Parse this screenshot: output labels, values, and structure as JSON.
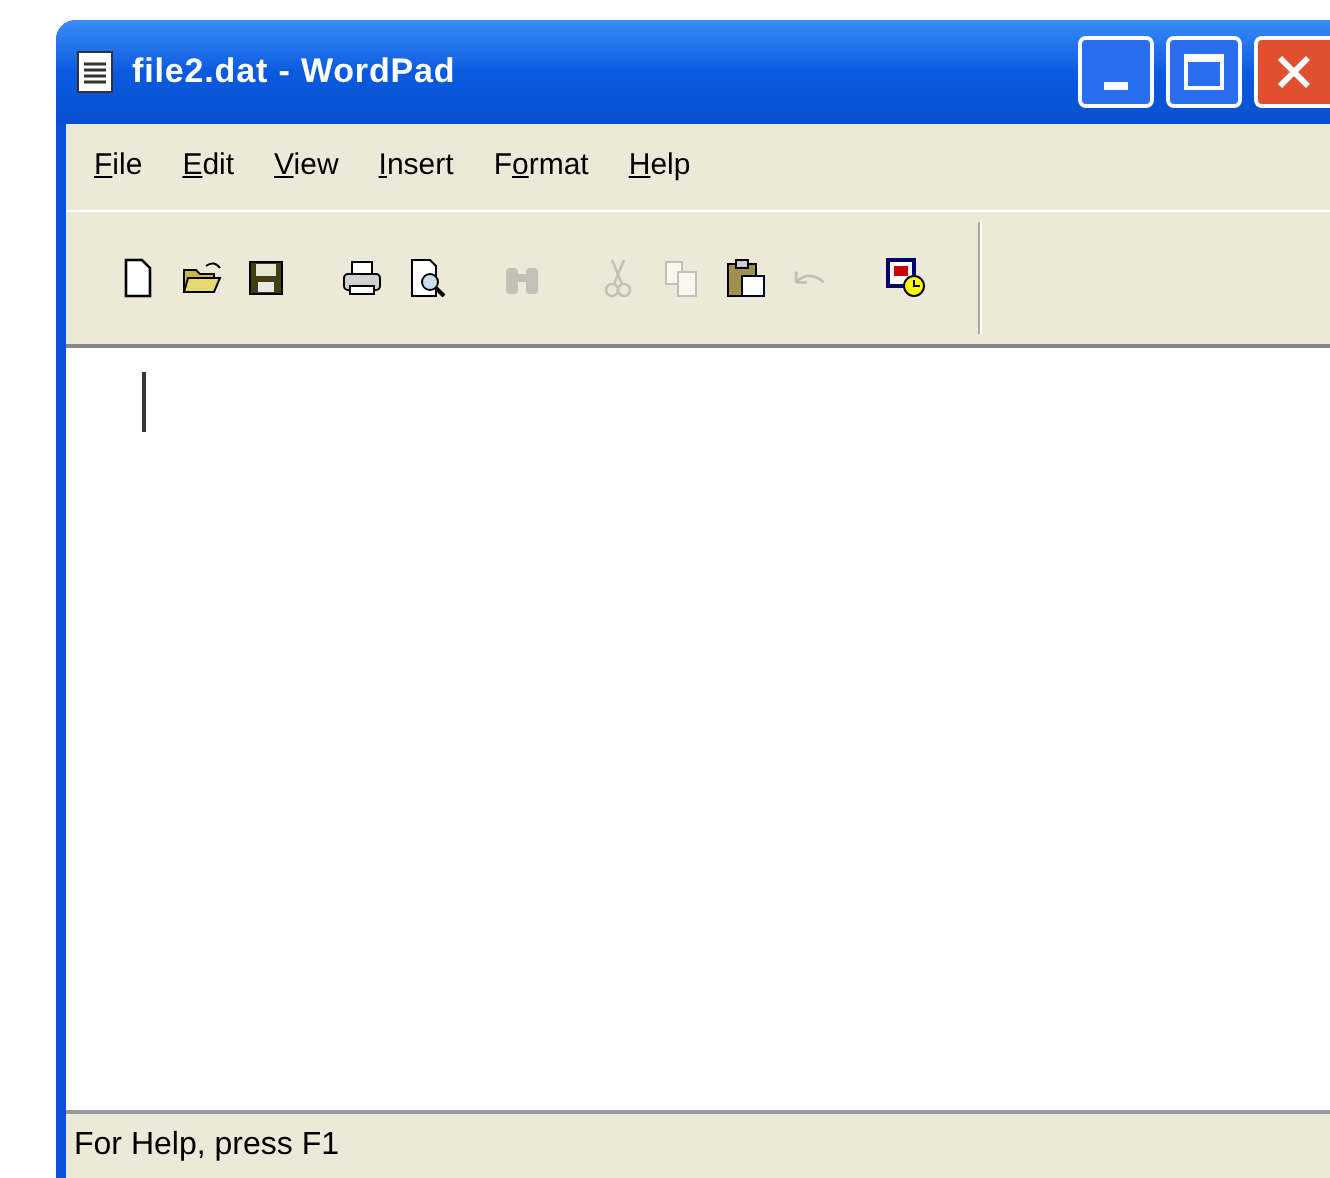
{
  "window": {
    "title": "file2.dat - WordPad"
  },
  "menu": [
    {
      "key": "F",
      "after": "ile"
    },
    {
      "key": "E",
      "after": "dit"
    },
    {
      "key": "V",
      "after": "iew"
    },
    {
      "key": "I",
      "after": "nsert"
    },
    {
      "before": "F",
      "key": "o",
      "after": "rmat"
    },
    {
      "key": "H",
      "after": "elp"
    }
  ],
  "toolbar": [
    {
      "kind": "new",
      "disabled": false
    },
    {
      "kind": "open",
      "disabled": false
    },
    {
      "kind": "save",
      "disabled": false
    },
    {
      "kind": "separator"
    },
    {
      "kind": "print",
      "disabled": false
    },
    {
      "kind": "preview",
      "disabled": false
    },
    {
      "kind": "separator"
    },
    {
      "kind": "find",
      "disabled": true
    },
    {
      "kind": "separator"
    },
    {
      "kind": "cut",
      "disabled": true
    },
    {
      "kind": "copy",
      "disabled": true
    },
    {
      "kind": "paste",
      "disabled": false
    },
    {
      "kind": "undo",
      "disabled": true
    },
    {
      "kind": "separator"
    },
    {
      "kind": "datetime",
      "disabled": false
    }
  ],
  "status_bar": {
    "text": "For Help, press F1"
  }
}
